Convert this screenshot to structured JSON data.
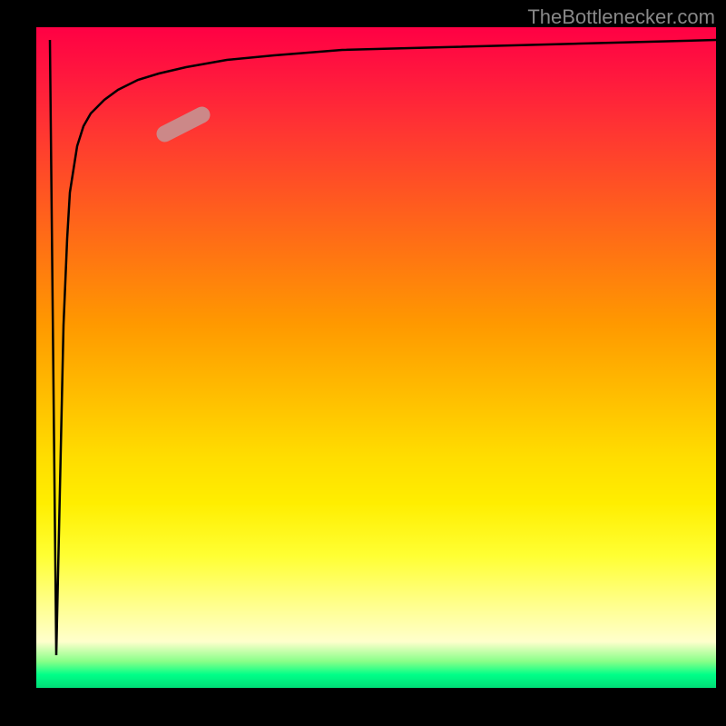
{
  "watermark": "TheBottlenecker.com",
  "chart_data": {
    "type": "line",
    "title": "",
    "xlabel": "",
    "ylabel": "",
    "xlim": [
      0,
      100
    ],
    "ylim": [
      0,
      100
    ],
    "background_gradient": {
      "type": "vertical",
      "stops": [
        {
          "pos": 0,
          "color": "#ff0044"
        },
        {
          "pos": 50,
          "color": "#ffcc00"
        },
        {
          "pos": 85,
          "color": "#ffff99"
        },
        {
          "pos": 100,
          "color": "#00dd77"
        }
      ]
    },
    "series": [
      {
        "name": "bottleneck-curve",
        "type": "line",
        "color": "#000000",
        "x": [
          2,
          3,
          3.5,
          4,
          4.5,
          5,
          6,
          7,
          8,
          10,
          12,
          15,
          18,
          22,
          28,
          35,
          45,
          60,
          80,
          100
        ],
        "y": [
          98,
          5,
          30,
          55,
          68,
          75,
          82,
          85,
          87,
          89,
          90.5,
          92,
          93,
          94,
          95,
          95.8,
          96.5,
          97,
          97.5,
          98
        ]
      }
    ],
    "marker": {
      "x_range": [
        18,
        26
      ],
      "y_range": [
        87,
        90
      ],
      "color": "#cc8888",
      "shape": "pill"
    }
  }
}
